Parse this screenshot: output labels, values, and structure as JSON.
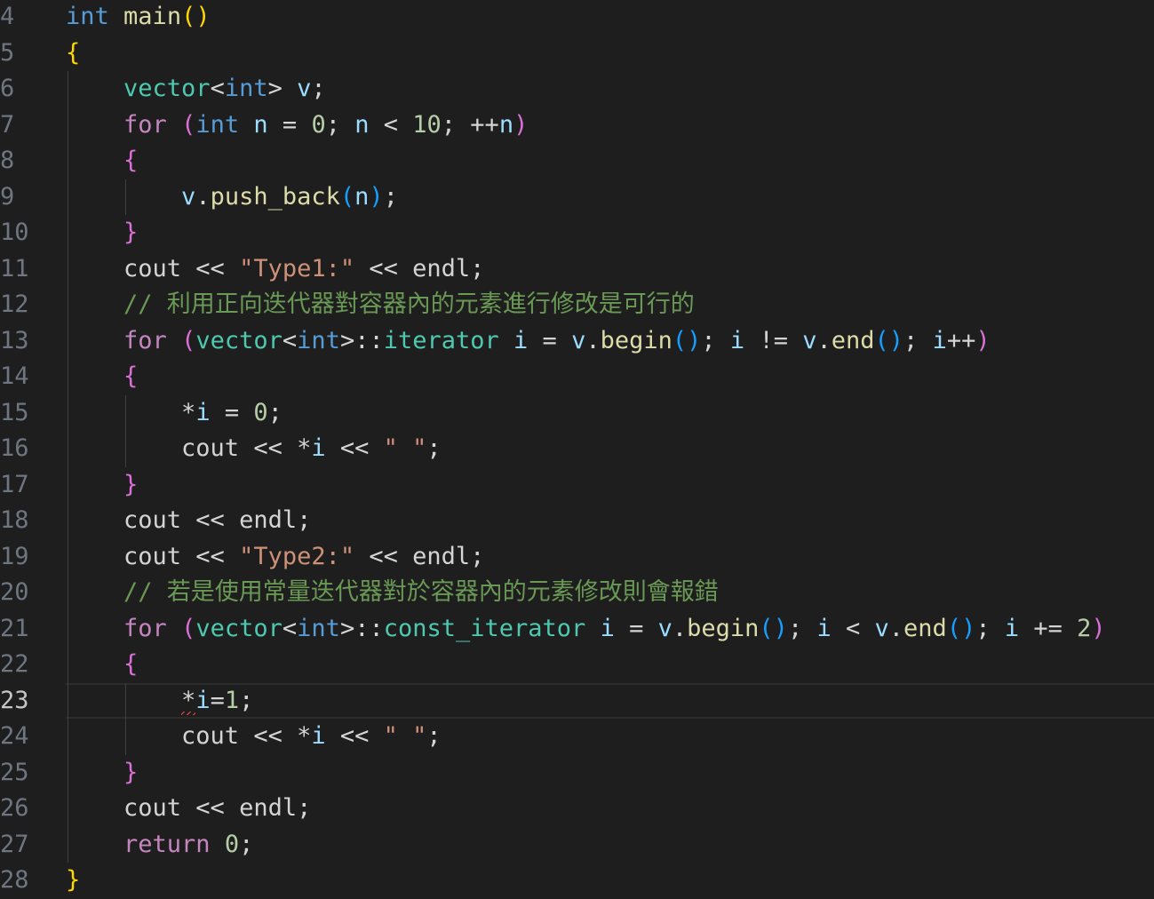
{
  "editor": {
    "language": "cpp",
    "theme": "dark",
    "current_line": 23,
    "lines": [
      {
        "number": "4",
        "tokens": [
          [
            "kw",
            "int"
          ],
          [
            "pl",
            " "
          ],
          [
            "fn",
            "main"
          ],
          [
            "b1",
            "()"
          ]
        ]
      },
      {
        "number": "5",
        "tokens": [
          [
            "b1",
            "{"
          ]
        ]
      },
      {
        "number": "6",
        "tokens": [
          [
            "pl",
            "    "
          ],
          [
            "typ",
            "vector"
          ],
          [
            "pl",
            "<"
          ],
          [
            "kw",
            "int"
          ],
          [
            "pl",
            "> "
          ],
          [
            "var",
            "v"
          ],
          [
            "pl",
            ";"
          ]
        ]
      },
      {
        "number": "7",
        "tokens": [
          [
            "pl",
            "    "
          ],
          [
            "ctrl",
            "for"
          ],
          [
            "pl",
            " "
          ],
          [
            "b2",
            "("
          ],
          [
            "kw",
            "int"
          ],
          [
            "pl",
            " "
          ],
          [
            "var",
            "n"
          ],
          [
            "pl",
            " = "
          ],
          [
            "num",
            "0"
          ],
          [
            "pl",
            "; "
          ],
          [
            "var",
            "n"
          ],
          [
            "pl",
            " < "
          ],
          [
            "num",
            "10"
          ],
          [
            "pl",
            "; ++"
          ],
          [
            "var",
            "n"
          ],
          [
            "b2",
            ")"
          ]
        ]
      },
      {
        "number": "8",
        "tokens": [
          [
            "pl",
            "    "
          ],
          [
            "b2",
            "{"
          ]
        ]
      },
      {
        "number": "9",
        "tokens": [
          [
            "pl",
            "        "
          ],
          [
            "var",
            "v"
          ],
          [
            "pl",
            "."
          ],
          [
            "fn",
            "push_back"
          ],
          [
            "b3",
            "("
          ],
          [
            "var",
            "n"
          ],
          [
            "b3",
            ")"
          ],
          [
            "pl",
            ";"
          ]
        ]
      },
      {
        "number": "10",
        "tokens": [
          [
            "pl",
            "    "
          ],
          [
            "b2",
            "}"
          ]
        ]
      },
      {
        "number": "11",
        "tokens": [
          [
            "pl",
            "    cout << "
          ],
          [
            "str",
            "\"Type1:\""
          ],
          [
            "pl",
            " << endl;"
          ]
        ]
      },
      {
        "number": "12",
        "tokens": [
          [
            "pl",
            "    "
          ],
          [
            "cm",
            "// 利用正向迭代器對容器內的元素進行修改是可行的"
          ]
        ]
      },
      {
        "number": "13",
        "tokens": [
          [
            "pl",
            "    "
          ],
          [
            "ctrl",
            "for"
          ],
          [
            "pl",
            " "
          ],
          [
            "b2",
            "("
          ],
          [
            "typ",
            "vector"
          ],
          [
            "pl",
            "<"
          ],
          [
            "kw",
            "int"
          ],
          [
            "pl",
            ">::"
          ],
          [
            "typ",
            "iterator"
          ],
          [
            "pl",
            " "
          ],
          [
            "var",
            "i"
          ],
          [
            "pl",
            " = "
          ],
          [
            "var",
            "v"
          ],
          [
            "pl",
            "."
          ],
          [
            "fn",
            "begin"
          ],
          [
            "b3",
            "()"
          ],
          [
            "pl",
            "; "
          ],
          [
            "var",
            "i"
          ],
          [
            "pl",
            " != "
          ],
          [
            "var",
            "v"
          ],
          [
            "pl",
            "."
          ],
          [
            "fn",
            "end"
          ],
          [
            "b3",
            "()"
          ],
          [
            "pl",
            "; "
          ],
          [
            "var",
            "i"
          ],
          [
            "pl",
            "++"
          ],
          [
            "b2",
            ")"
          ]
        ]
      },
      {
        "number": "14",
        "tokens": [
          [
            "pl",
            "    "
          ],
          [
            "b2",
            "{"
          ]
        ]
      },
      {
        "number": "15",
        "tokens": [
          [
            "pl",
            "        *"
          ],
          [
            "var",
            "i"
          ],
          [
            "pl",
            " = "
          ],
          [
            "num",
            "0"
          ],
          [
            "pl",
            ";"
          ]
        ]
      },
      {
        "number": "16",
        "tokens": [
          [
            "pl",
            "        cout << *"
          ],
          [
            "var",
            "i"
          ],
          [
            "pl",
            " << "
          ],
          [
            "str",
            "\" \""
          ],
          [
            "pl",
            ";"
          ]
        ]
      },
      {
        "number": "17",
        "tokens": [
          [
            "pl",
            "    "
          ],
          [
            "b2",
            "}"
          ]
        ]
      },
      {
        "number": "18",
        "tokens": [
          [
            "pl",
            "    cout << endl;"
          ]
        ]
      },
      {
        "number": "19",
        "tokens": [
          [
            "pl",
            "    cout << "
          ],
          [
            "str",
            "\"Type2:\""
          ],
          [
            "pl",
            " << endl;"
          ]
        ]
      },
      {
        "number": "20",
        "tokens": [
          [
            "pl",
            "    "
          ],
          [
            "cm",
            "// 若是使用常量迭代器對於容器內的元素修改則會報錯"
          ]
        ]
      },
      {
        "number": "21",
        "tokens": [
          [
            "pl",
            "    "
          ],
          [
            "ctrl",
            "for"
          ],
          [
            "pl",
            " "
          ],
          [
            "b2",
            "("
          ],
          [
            "typ",
            "vector"
          ],
          [
            "pl",
            "<"
          ],
          [
            "kw",
            "int"
          ],
          [
            "pl",
            ">::"
          ],
          [
            "typ",
            "const_iterator"
          ],
          [
            "pl",
            " "
          ],
          [
            "var",
            "i"
          ],
          [
            "pl",
            " = "
          ],
          [
            "var",
            "v"
          ],
          [
            "pl",
            "."
          ],
          [
            "fn",
            "begin"
          ],
          [
            "b3",
            "()"
          ],
          [
            "pl",
            "; "
          ],
          [
            "var",
            "i"
          ],
          [
            "pl",
            " < "
          ],
          [
            "var",
            "v"
          ],
          [
            "pl",
            "."
          ],
          [
            "fn",
            "end"
          ],
          [
            "b3",
            "()"
          ],
          [
            "pl",
            "; "
          ],
          [
            "var",
            "i"
          ],
          [
            "pl",
            " += "
          ],
          [
            "num",
            "2"
          ],
          [
            "b2",
            ")"
          ]
        ]
      },
      {
        "number": "22",
        "tokens": [
          [
            "pl",
            "    "
          ],
          [
            "b2",
            "{"
          ]
        ]
      },
      {
        "number": "23",
        "tokens": [
          [
            "pl",
            "        *"
          ],
          [
            "var",
            "i"
          ],
          [
            "pl",
            "="
          ],
          [
            "num",
            "1"
          ],
          [
            "pl",
            ";"
          ]
        ]
      },
      {
        "number": "24",
        "tokens": [
          [
            "pl",
            "        cout << *"
          ],
          [
            "var",
            "i"
          ],
          [
            "pl",
            " << "
          ],
          [
            "str",
            "\" \""
          ],
          [
            "pl",
            ";"
          ]
        ]
      },
      {
        "number": "25",
        "tokens": [
          [
            "pl",
            "    "
          ],
          [
            "b2",
            "}"
          ]
        ]
      },
      {
        "number": "26",
        "tokens": [
          [
            "pl",
            "    cout << endl;"
          ]
        ]
      },
      {
        "number": "27",
        "tokens": [
          [
            "pl",
            "    "
          ],
          [
            "ctrl",
            "return"
          ],
          [
            "pl",
            " "
          ],
          [
            "num",
            "0"
          ],
          [
            "pl",
            ";"
          ]
        ]
      },
      {
        "number": "28",
        "tokens": [
          [
            "b1",
            "}"
          ]
        ]
      }
    ],
    "colors": {
      "background": "#1e1e1e",
      "keyword": "#569cd6",
      "control": "#c586c0",
      "function": "#dcdcaa",
      "variable": "#9cdcfe",
      "type": "#4ec9b0",
      "number": "#b5cea8",
      "string": "#ce9178",
      "comment": "#6a9955",
      "error_squiggle": "#f14c4c"
    }
  }
}
